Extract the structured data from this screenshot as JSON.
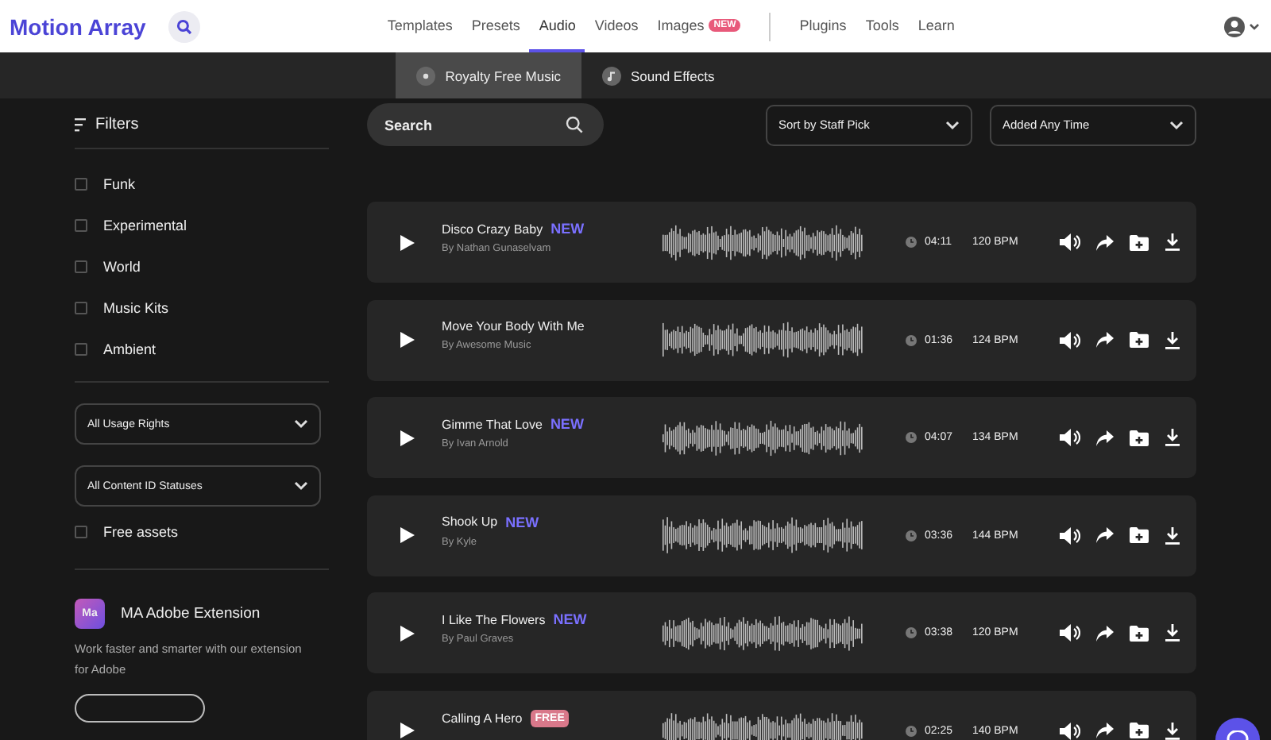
{
  "header": {
    "logo": "Motion Array",
    "nav": [
      {
        "label": "Templates",
        "selected": false
      },
      {
        "label": "Presets",
        "selected": false
      },
      {
        "label": "Audio",
        "selected": true
      },
      {
        "label": "Videos",
        "selected": false
      },
      {
        "label": "Images",
        "selected": false,
        "badge": "NEW"
      }
    ],
    "nav_secondary": [
      "Plugins",
      "Tools",
      "Learn"
    ]
  },
  "subnav": {
    "tabs": [
      {
        "label": "Royalty Free Music",
        "selected": true
      },
      {
        "label": "Sound Effects",
        "selected": false
      }
    ]
  },
  "sidebar": {
    "title": "Filters",
    "genres": [
      {
        "label": "Funk",
        "checked": false
      },
      {
        "label": "Experimental",
        "checked": false
      },
      {
        "label": "World",
        "checked": false
      },
      {
        "label": "Music Kits",
        "checked": false
      },
      {
        "label": "Ambient",
        "checked": false
      }
    ],
    "dropdowns": [
      "All Usage Rights",
      "All Content ID Statuses"
    ],
    "free_assets": {
      "label": "Free assets",
      "checked": false
    },
    "extension": {
      "badge": "Ma",
      "title": "MA Adobe Extension",
      "description": "Work faster and smarter with our extension for Adobe"
    }
  },
  "toolbar": {
    "search": {
      "placeholder": "Search"
    },
    "sort": "Sort by Staff Pick",
    "date": "Added Any Time"
  },
  "tracks": [
    {
      "title": "Disco Crazy Baby",
      "tag": {
        "kind": "new",
        "label": "NEW"
      },
      "author": "By Nathan Gunaselvam",
      "duration": "04:11",
      "bpm": "120 BPM"
    },
    {
      "title": "Move Your Body With Me",
      "author": "By Awesome Music",
      "duration": "01:36",
      "bpm": "124 BPM"
    },
    {
      "title": "Gimme That Love",
      "tag": {
        "kind": "new",
        "label": "NEW"
      },
      "author": "By Ivan Arnold",
      "duration": "04:07",
      "bpm": "134 BPM"
    },
    {
      "title": "Shook Up",
      "tag": {
        "kind": "new",
        "label": "NEW"
      },
      "author": "By Kyle",
      "duration": "03:36",
      "bpm": "144 BPM"
    },
    {
      "title": "I Like The Flowers",
      "tag": {
        "kind": "new",
        "label": "NEW"
      },
      "author": "By Paul Graves",
      "duration": "03:38",
      "bpm": "120 BPM"
    },
    {
      "title": "Calling A Hero",
      "tag": {
        "kind": "free",
        "label": "FREE"
      },
      "duration": "02:25",
      "bpm": "140 BPM"
    }
  ]
}
